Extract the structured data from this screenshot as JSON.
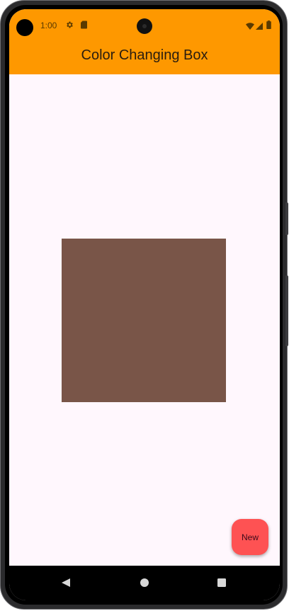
{
  "status_bar": {
    "time": "1:00",
    "icons": [
      "gear-icon",
      "sd-card-icon",
      "wifi-icon",
      "signal-icon",
      "battery-icon"
    ]
  },
  "app_bar": {
    "title": "Color Changing Box",
    "color": "#fe9800"
  },
  "main": {
    "box_color": "#795548"
  },
  "fab": {
    "label": "New",
    "color": "#fe5253"
  },
  "navigation_bar": {
    "buttons": [
      "back-icon",
      "home-icon",
      "recents-icon"
    ]
  },
  "colors": {
    "background": "#fff7fd"
  }
}
